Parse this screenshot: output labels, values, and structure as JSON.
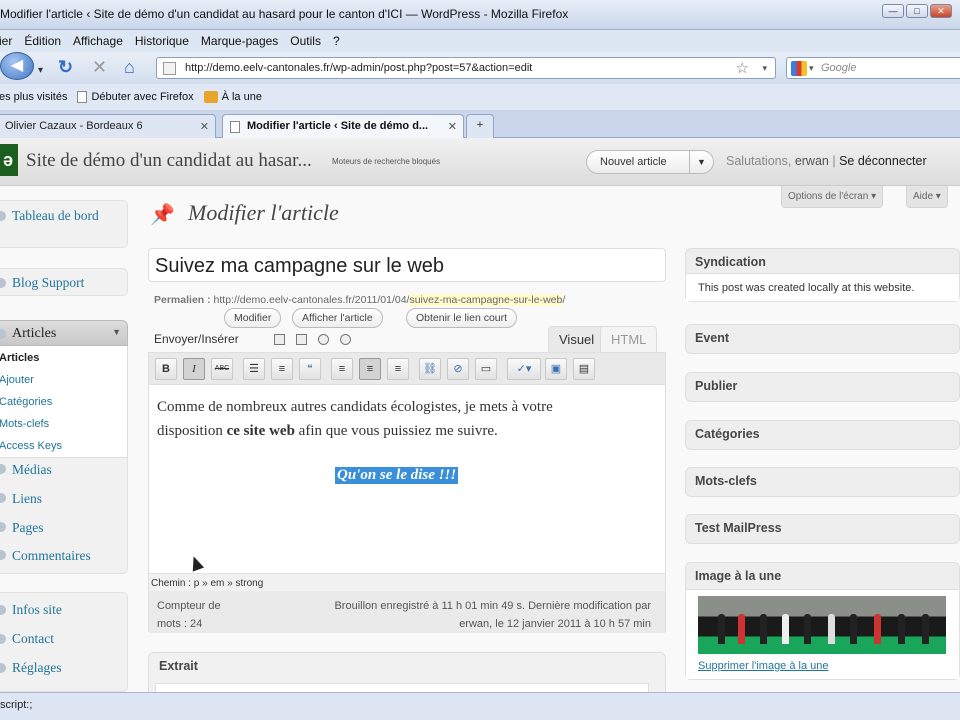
{
  "window": {
    "title": "Modifier l'article ‹ Site de démo d'un candidat au hasard pour le canton d'ICI — WordPress - Mozilla Firefox"
  },
  "menu": [
    "Fichier",
    "Édition",
    "Affichage",
    "Historique",
    "Marque-pages",
    "Outils",
    "?"
  ],
  "menu_visible": [
    "ier",
    "Édition",
    "Affichage",
    "Historique",
    "Marque-pages",
    "Outils",
    "?"
  ],
  "nav": {
    "url": "http://demo.eelv-cantonales.fr/wp-admin/post.php?post=57&action=edit",
    "search_placeholder": "Google"
  },
  "bookmarks": [
    "es plus visités",
    "Débuter avec Firefox",
    "À la une"
  ],
  "tabs": [
    {
      "label": "Olivier Cazaux - Bordeaux 6",
      "active": false
    },
    {
      "label": "Modifier l'article ‹ Site de démo d...",
      "active": true
    }
  ],
  "wp_header": {
    "site_title": "Site de démo d'un candidat au hasar...",
    "blocked": "Moteurs de recherche bloqués",
    "new_post": "Nouvel article",
    "greeting": "Salutations,",
    "user": "erwan",
    "logout": "Se déconnecter"
  },
  "sidebar": {
    "dashboard": "Tableau de bord",
    "blog_support": "Blog Support",
    "articles": "Articles",
    "articles_sub": [
      "Articles",
      "Ajouter",
      "Catégories",
      "Mots-clefs",
      "Access Keys"
    ],
    "items": [
      "Médias",
      "Liens",
      "Pages",
      "Commentaires"
    ],
    "items2": [
      "Infos site",
      "Contact",
      "Réglages"
    ]
  },
  "screen_options": {
    "options": "Options de l'écran ▾",
    "help": "Aide ▾"
  },
  "page_title": "Modifier l'article",
  "post": {
    "title": "Suivez ma campagne sur le web",
    "permalink_label": "Permalien :",
    "permalink_base": "http://demo.eelv-cantonales.fr/2011/01/04/",
    "permalink_slug": "suivez-ma-campagne-sur-le-web",
    "btn_modify": "Modifier",
    "btn_view": "Afficher l'article",
    "btn_shortlink": "Obtenir le lien court",
    "upload_label": "Envoyer/Insérer",
    "tab_visual": "Visuel",
    "tab_html": "HTML",
    "body_line1": "Comme de nombreux autres candidats écologistes, je mets à votre",
    "body_line2_pre": "disposition",
    "body_line2_bold": "ce site web",
    "body_line2_post": "afin que vous puissiez me suivre.",
    "quote": "Qu'on se le dise !!!",
    "path": "Chemin : p » em » strong",
    "word_count_label": "Compteur de",
    "word_count_value": "mots : 24",
    "saved_line1": "Brouillon enregistré à 11 h 01 min 49 s. Dernière modification par",
    "saved_line2": "erwan, le 12 janvier 2011 à 10 h 57 min",
    "excerpt": "Extrait"
  },
  "boxes": {
    "syndication": "Syndication",
    "syndication_text": "This post was created locally at this website.",
    "event": "Event",
    "publish": "Publier",
    "categories": "Catégories",
    "tags": "Mots-clefs",
    "mailpress": "Test MailPress",
    "featured": "Image à la une",
    "remove_image": "Supprimer l'image à la une"
  },
  "status": "script:;"
}
